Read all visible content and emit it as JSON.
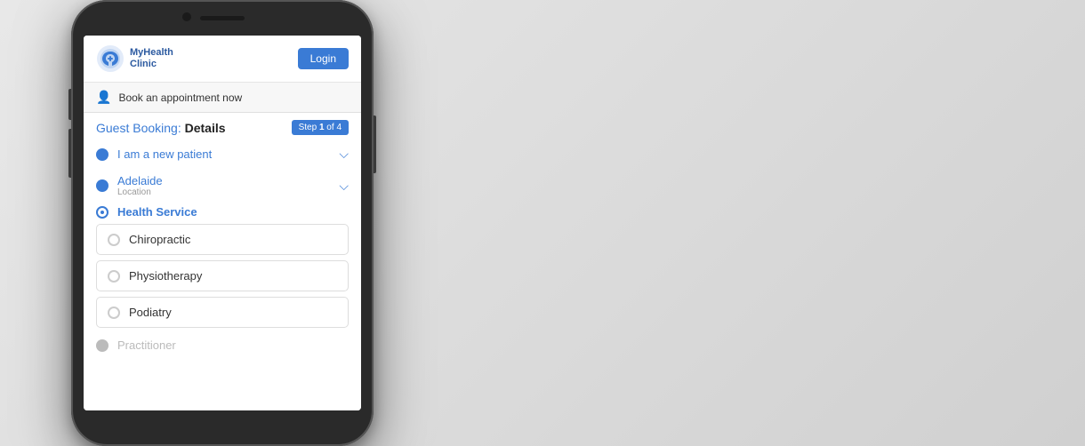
{
  "background": "#d8d8d8",
  "header": {
    "logo_name": "MyHealth",
    "logo_sub": "Clinic",
    "login_label": "Login"
  },
  "book_bar": {
    "icon": "👤",
    "text": "Book an appointment now"
  },
  "booking": {
    "title_prefix": "Guest Booking: ",
    "title_highlight": "Details",
    "step_text": "Step ",
    "step_current": "1",
    "step_separator": " of ",
    "step_total": "4"
  },
  "form_items": [
    {
      "label": "I am a new patient",
      "type": "dropdown",
      "dot": "filled"
    },
    {
      "label": "Adelaide",
      "sublabel": "Location",
      "type": "dropdown",
      "dot": "filled"
    }
  ],
  "health_service": {
    "title": "Health Service",
    "options": [
      {
        "label": "Chiropractic",
        "selected": false
      },
      {
        "label": "Physiotherapy",
        "selected": false
      },
      {
        "label": "Podiatry",
        "selected": false
      }
    ]
  },
  "practitioner": {
    "label": "Practitioner"
  }
}
